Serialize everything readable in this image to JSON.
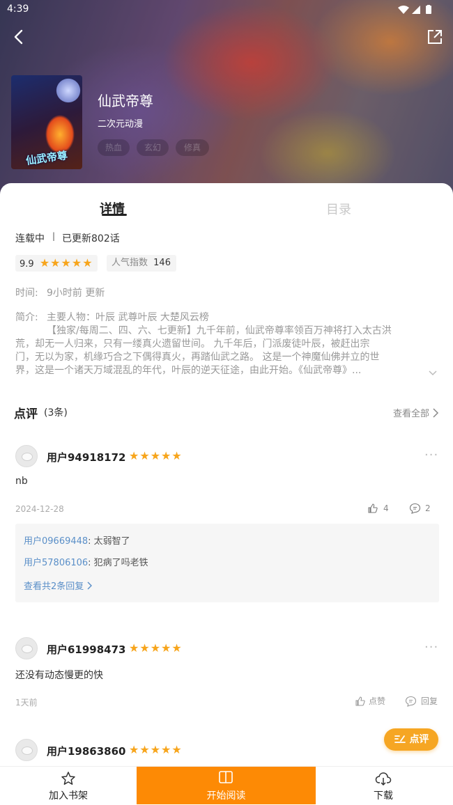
{
  "status_bar": {
    "time": "4:39"
  },
  "header": {
    "back_icon": "back-chevron-icon",
    "share_icon": "share-icon",
    "title": "仙武帝尊",
    "category": "二次元动漫",
    "tags": [
      "热血",
      "玄幻",
      "修真"
    ],
    "cover_text": "仙武帝尊"
  },
  "tabs": {
    "detail": "详情",
    "catalog": "目录"
  },
  "info": {
    "status": "连载中",
    "separator": "|",
    "updated": "已更新802话",
    "score": "9.9",
    "stars": "★★★★★",
    "popularity_label": "人气指数",
    "popularity_value": "146",
    "time_label": "时间:",
    "time_value": "9小时前 更新",
    "intro_label": "简介:",
    "intro_line1": "主要人物：叶辰 武尊叶辰 大楚风云榜",
    "intro_line2": "【独家/每周二、四、六、七更新】九千年前，仙武帝尊率领百万神将打入太古洪",
    "intro_line3": "荒，却无一人归来，只有一缕真火遗留世间。 九千年后，门派废徒叶辰，被赶出宗",
    "intro_line4": "门，无以为家，机缘巧合之下偶得真火，再踏仙武之路。 这是一个神魔仙佛并立的世",
    "intro_line5": "界，这是一个诸天万域混乱的年代，叶辰的逆天征途，由此开始。《仙武帝尊》..."
  },
  "reviews": {
    "heading": "点评",
    "count": "(3条)",
    "view_all": "查看全部",
    "items": [
      {
        "user": "用户94918172",
        "stars": "★★★★★",
        "text": "nb",
        "date": "2024-12-28",
        "likes": "4",
        "replies": "2",
        "reply_list": [
          {
            "user": "用户09669448",
            "text": ": 太弱智了"
          },
          {
            "user": "用户57806106",
            "text": ": 犯病了吗老铁"
          }
        ],
        "view_replies": "查看共2条回复"
      },
      {
        "user": "用户61998473",
        "stars": "★★★★★",
        "text": "还没有动态慢更的快",
        "date": "1天前",
        "like_label": "点赞",
        "reply_label": "回复"
      },
      {
        "user": "用户19863860",
        "stars": "★★★★★"
      }
    ],
    "comment_button": "点评"
  },
  "bottom_bar": {
    "add_shelf": "加入书架",
    "start_reading": "开始阅读",
    "download": "下载"
  },
  "colors": {
    "accent": "#fd8a05",
    "star": "#f7a51c",
    "link": "#5a8fc8"
  }
}
